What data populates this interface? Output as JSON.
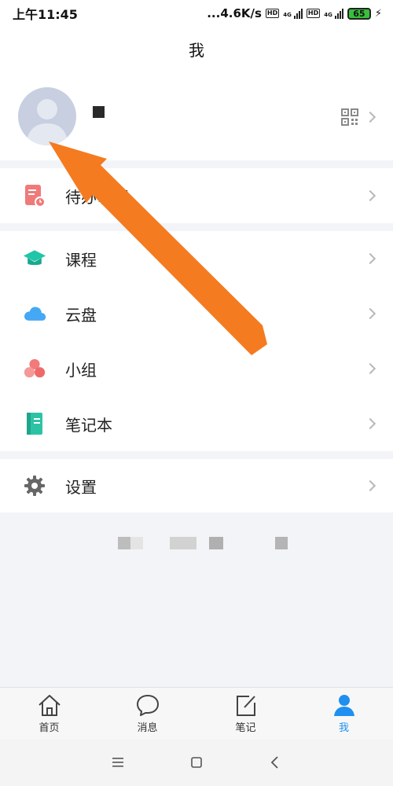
{
  "status_bar": {
    "time": "上午11:45",
    "speed": "...4.6K/s",
    "hd": "HD",
    "net": "4G",
    "battery": "65"
  },
  "header": {
    "title": "我"
  },
  "menu": [
    {
      "label": "待办事项",
      "icon": "todo-icon",
      "color": "#f07a7a"
    },
    {
      "label": "课程",
      "icon": "graduation-cap-icon",
      "color": "#1fc5a8"
    },
    {
      "label": "云盘",
      "icon": "cloud-icon",
      "color": "#45a8f5"
    },
    {
      "label": "小组",
      "icon": "group-icon",
      "color": "#f27a7a"
    },
    {
      "label": "笔记本",
      "icon": "notebook-icon",
      "color": "#2cc3a5"
    },
    {
      "label": "设置",
      "icon": "gear-icon",
      "color": "#666666"
    }
  ],
  "tabs": [
    {
      "label": "首页",
      "icon": "home-icon"
    },
    {
      "label": "消息",
      "icon": "message-icon"
    },
    {
      "label": "笔记",
      "icon": "note-edit-icon"
    },
    {
      "label": "我",
      "icon": "user-icon",
      "active": true
    }
  ],
  "colors": {
    "accent": "#1f8ff0",
    "annotation_arrow": "#f47b20",
    "background": "#f2f4f7"
  }
}
